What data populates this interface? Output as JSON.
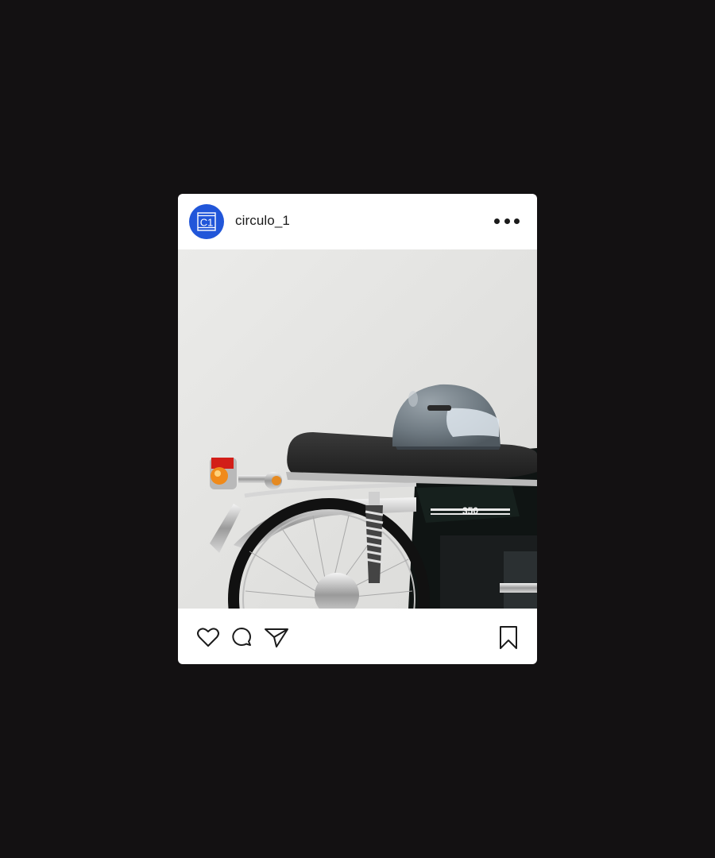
{
  "post": {
    "username": "circulo_1",
    "avatar": {
      "icon": "circulo-logo-icon",
      "text": "C1",
      "color": "#2156d9"
    },
    "more_icon": "more-horizontal-icon",
    "image": {
      "icon": "motorcycle-photo",
      "badge_text": "350"
    },
    "actions": {
      "like_icon": "heart-icon",
      "comment_icon": "comment-icon",
      "share_icon": "send-icon",
      "save_icon": "bookmark-icon"
    }
  }
}
